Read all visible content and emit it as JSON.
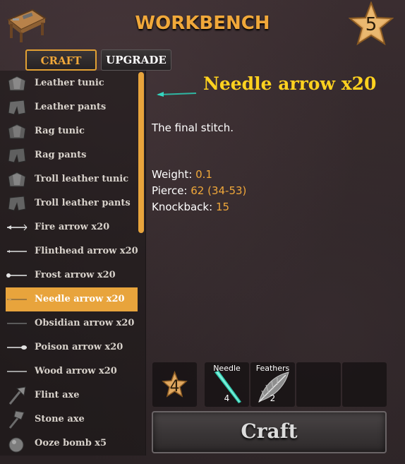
{
  "header": {
    "title": "WORKBENCH",
    "station_level": "5",
    "station_icon": "workbench-icon"
  },
  "tabs": [
    {
      "label": "CRAFT",
      "active": true
    },
    {
      "label": "UPGRADE",
      "active": false
    }
  ],
  "recipes": [
    {
      "label": "Leather tunic",
      "icon": "tunic-icon"
    },
    {
      "label": "Leather pants",
      "icon": "pants-icon"
    },
    {
      "label": "Rag tunic",
      "icon": "tunic-icon"
    },
    {
      "label": "Rag pants",
      "icon": "pants-icon"
    },
    {
      "label": "Troll leather tunic",
      "icon": "tunic-icon"
    },
    {
      "label": "Troll leather pants",
      "icon": "pants-icon"
    },
    {
      "label": "Fire arrow x20",
      "icon": "arrow-icon"
    },
    {
      "label": "Flinthead arrow x20",
      "icon": "arrow-icon"
    },
    {
      "label": "Frost arrow x20",
      "icon": "arrow-icon"
    },
    {
      "label": "Needle arrow x20",
      "icon": "arrow-icon",
      "selected": true
    },
    {
      "label": "Obsidian arrow x20",
      "icon": "arrow-icon"
    },
    {
      "label": "Poison arrow x20",
      "icon": "arrow-icon"
    },
    {
      "label": "Wood arrow x20",
      "icon": "arrow-icon"
    },
    {
      "label": "Flint axe",
      "icon": "axe-icon"
    },
    {
      "label": "Stone axe",
      "icon": "axe-icon"
    },
    {
      "label": "Ooze bomb x5",
      "icon": "bomb-icon"
    }
  ],
  "selected_item": {
    "name": "Needle arrow x20",
    "description": "The final stitch.",
    "stats": {
      "weight_label": "Weight:",
      "weight_value": "0.1",
      "pierce_label": "Pierce:",
      "pierce_value": "62 (34-53)",
      "knockback_label": "Knockback:",
      "knockback_value": "15"
    }
  },
  "requirements": {
    "level": "4",
    "items": [
      {
        "name": "Needle",
        "amount": "4",
        "icon": "needle-icon"
      },
      {
        "name": "Feathers",
        "amount": "2",
        "icon": "feather-icon"
      }
    ]
  },
  "craft_button": {
    "label": "Craft"
  },
  "colors": {
    "accent": "#e8a43c",
    "title": "#f0a83a",
    "item_name": "#ffd21f",
    "stat_value": "#f0a83a"
  }
}
